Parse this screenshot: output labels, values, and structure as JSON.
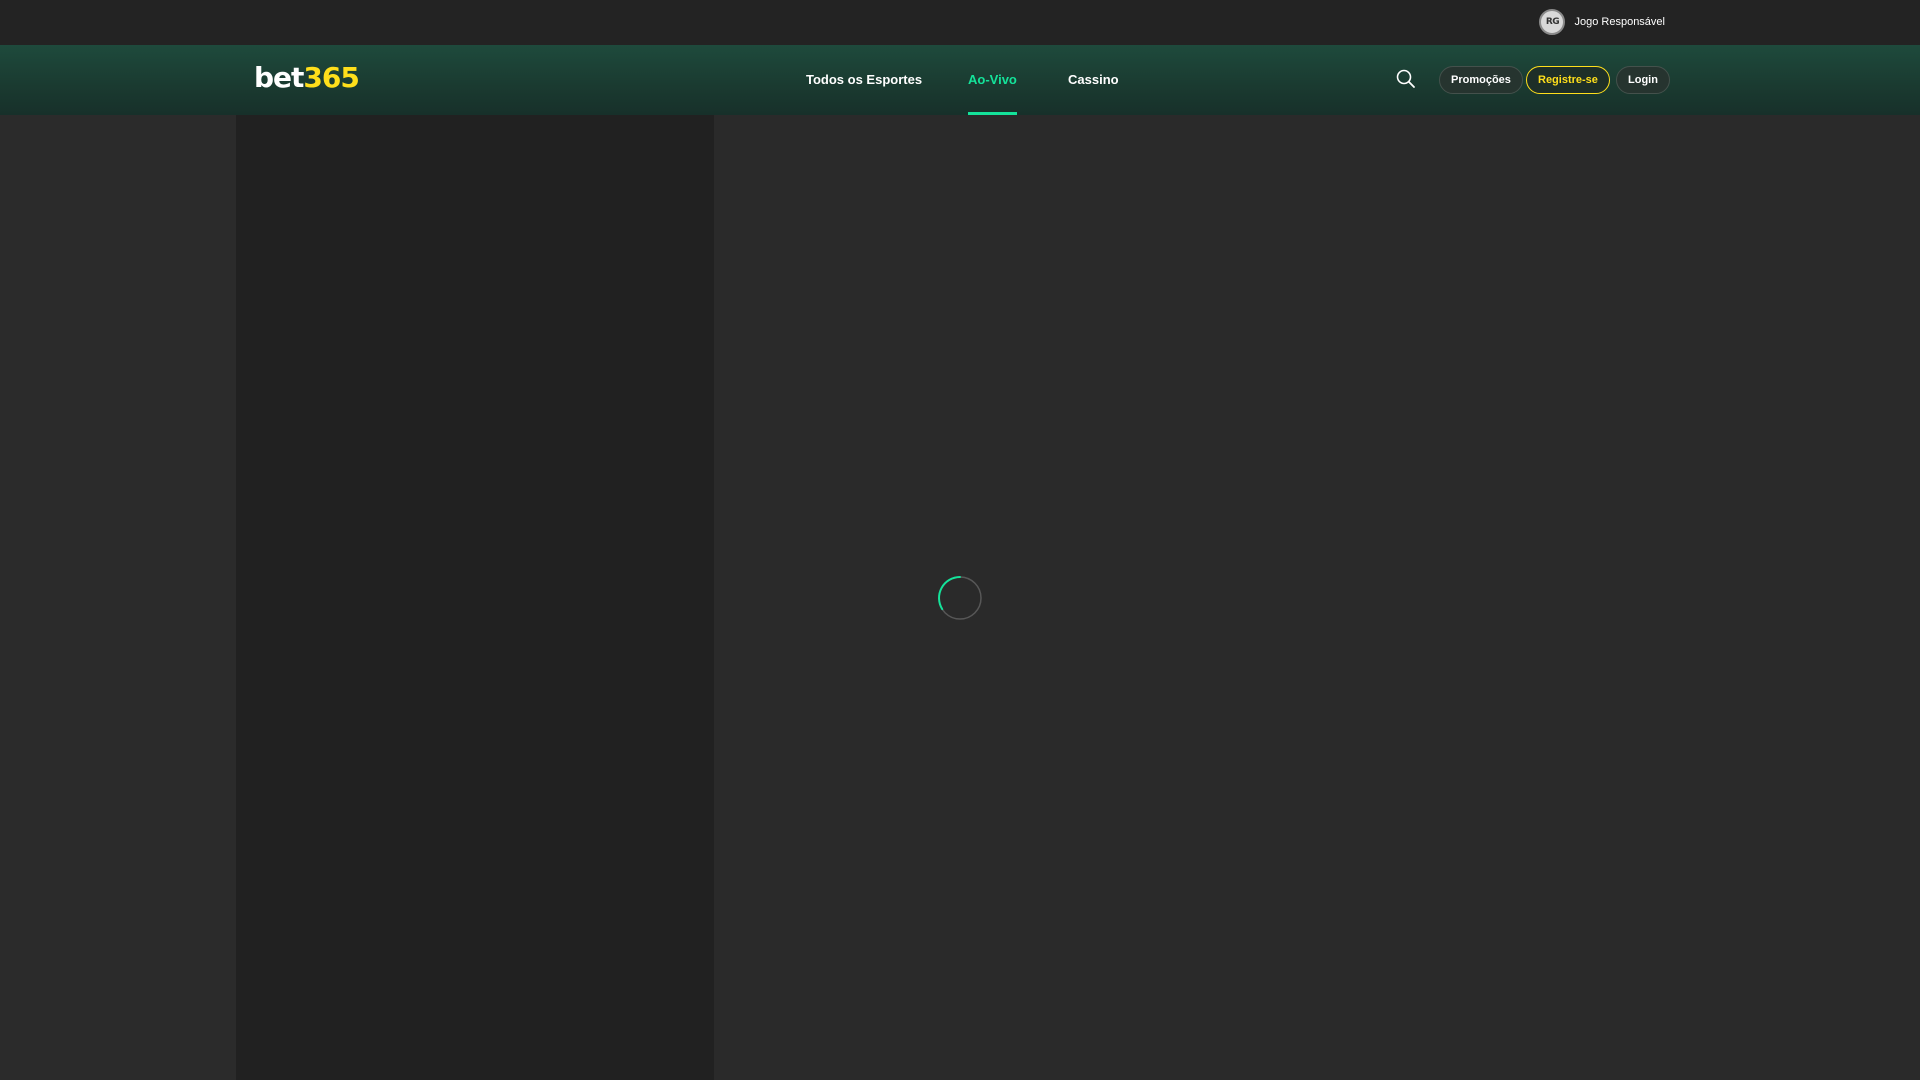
{
  "topbar": {
    "rg_badge": "RG",
    "responsible_gaming": "Jogo Responsável"
  },
  "header": {
    "logo": {
      "part1": "bet",
      "part2": "365"
    },
    "nav": [
      {
        "label": "Todos os Esportes",
        "active": false
      },
      {
        "label": "Ao-Vivo",
        "active": true
      },
      {
        "label": "Cassino",
        "active": false
      }
    ],
    "search_icon": "search-icon",
    "buttons": {
      "promotions": "Promoções",
      "register": "Registre-se",
      "login": "Login"
    }
  },
  "main": {
    "loading": true,
    "spinner_icon": "loading-spinner-icon"
  },
  "colors": {
    "accent_green": "#14e39a",
    "brand_yellow": "#ffdf1b",
    "nav_bg": "#1e4a3c",
    "topbar_bg": "#232323",
    "sidebar_bg": "#212121",
    "content_bg": "#2a2a2a"
  }
}
